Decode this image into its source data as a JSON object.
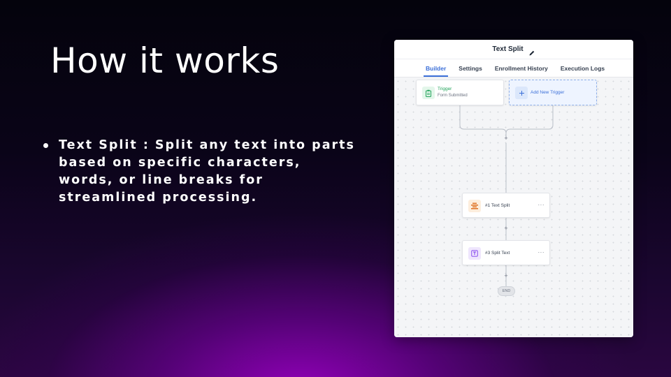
{
  "slide": {
    "title": "How it works",
    "bullets": [
      "Text Split : Split any text into parts based on specific characters, words, or line breaks for streamlined processing."
    ]
  },
  "app": {
    "title": "Text Split",
    "tabs": [
      {
        "label": "Builder",
        "active": true
      },
      {
        "label": "Settings",
        "active": false
      },
      {
        "label": "Enrollment History",
        "active": false
      },
      {
        "label": "Execution Logs",
        "active": false
      }
    ],
    "workflow": {
      "trigger": {
        "label": "Trigger",
        "sublabel": "Form Submitted",
        "icon": "clipboard-icon"
      },
      "add_trigger": {
        "label": "Add New Trigger",
        "icon": "plus-icon"
      },
      "actions": [
        {
          "label": "#1 Text Split",
          "icon": "text-split-icon"
        },
        {
          "label": "#3 Split Text",
          "icon": "text-t-icon"
        }
      ],
      "plus_symbol": "+",
      "more_symbol": "···",
      "end_label": "END"
    },
    "colors": {
      "accent": "#3b6fd8",
      "trigger_icon": "#22a35a",
      "split_icon": "#e0762a",
      "text_icon": "#7c3aed"
    }
  }
}
